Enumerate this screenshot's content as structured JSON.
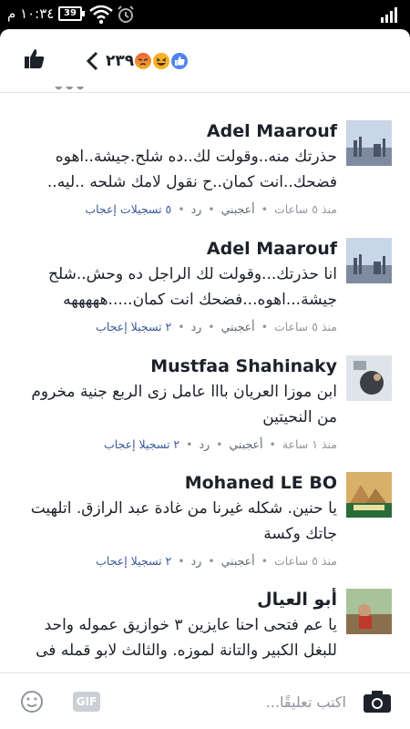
{
  "status_bar": {
    "time": "١٠:٣٤ م",
    "battery": "39"
  },
  "topbar": {
    "reaction_count": "٢٣٩"
  },
  "comments": [
    {
      "author": "Adel Maarouf",
      "text": "حذرتك منه..وقولت لك..ده شلح.جيشة..اهوه فضحك..انت كمان..ح نقول لامك شلحه ..ليه..",
      "time": "منذ ٥ ساعات",
      "like": "أعجبني",
      "reply": "رد",
      "reacts": "٥ تسجيلات إعجاب"
    },
    {
      "author": "Adel Maarouf",
      "text": "انا حذرتك...وقولت لك الراجل ده وحش..شلح جيشة...اهوه...فضحك انت كمان.....هههههه",
      "time": "منذ ٥ ساعات",
      "like": "أعجبني",
      "reply": "رد",
      "reacts": "٢ تسجيلا إعجاب"
    },
    {
      "author": "Mustfaa Shahinaky",
      "text": "ابن موزا العريان بااا عامل زى الربع جنية مخروم من النحيتين",
      "time": "منذ ١ ساعة",
      "like": "أعجبني",
      "reply": "رد",
      "reacts": "٢ تسجيلا إعجاب"
    },
    {
      "author": "Mohaned LE BO",
      "text": "يا حنين. شكله غيرنا من غادة عبد الرازق. اتلهيت جاتك وكسة",
      "time": "منذ ٥ ساعات",
      "like": "أعجبني",
      "reply": "رد",
      "reacts": "٢ تسجيلا إعجاب"
    },
    {
      "author": "أبو العيال",
      "text": "يا عم فتحى احنا عايزين ٣ خوازيق عموله واحد للبغل الكبير والتانة لموزه. والثالث لابو قمله فى",
      "time": "",
      "like": "",
      "reply": "",
      "reacts": ""
    }
  ],
  "composer": {
    "placeholder": "اكتب تعليقًا...",
    "gif_label": "GIF"
  },
  "colors": {
    "link_blue": "#385898",
    "meta_gray": "#90949c",
    "text": "#1d2129"
  }
}
